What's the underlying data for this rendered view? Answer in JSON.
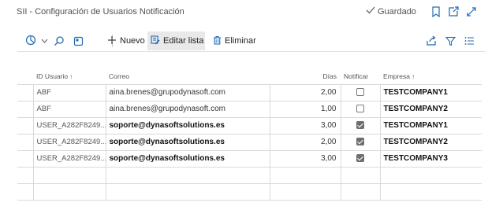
{
  "header": {
    "title": "SII - Configuración de Usuarios Notificación",
    "status": "Guardado"
  },
  "toolbar": {
    "nuevo_label": "Nuevo",
    "editar_lista_label": "Editar lista",
    "eliminar_label": "Eliminar"
  },
  "table": {
    "columns": {
      "id_usuario": "ID Usuario",
      "correo": "Correo",
      "dias": "Días",
      "notificar": "Notificar",
      "empresa": "Empresa"
    },
    "rows": [
      {
        "id_usuario": "ABF",
        "correo": "aina.brenes@grupodynasoft.com",
        "dias": "2,00",
        "notificar": false,
        "empresa": "TESTCOMPANY1"
      },
      {
        "id_usuario": "ABF",
        "correo": "aina.brenes@grupodynasoft.com",
        "dias": "1,00",
        "notificar": false,
        "empresa": "TESTCOMPANY2"
      },
      {
        "id_usuario": "USER_A282F8249...",
        "correo": "soporte@dynasoftsolutions.es",
        "dias": "3,00",
        "notificar": true,
        "empresa": "TESTCOMPANY1"
      },
      {
        "id_usuario": "USER_A282F8249...",
        "correo": "soporte@dynasoftsolutions.es",
        "dias": "2,00",
        "notificar": true,
        "empresa": "TESTCOMPANY2"
      },
      {
        "id_usuario": "USER_A282F8249...",
        "correo": "soporte@dynasoftsolutions.es",
        "dias": "3,00",
        "notificar": true,
        "empresa": "TESTCOMPANY3"
      }
    ]
  },
  "icons": {
    "saved": "checkmark-icon",
    "bookmark": "bookmark-icon",
    "open_new": "open-new-window-icon",
    "expand": "expand-icon",
    "analysis": "analysis-mode-icon",
    "search": "search-icon",
    "view": "view-icon",
    "share": "share-icon",
    "filter": "filter-icon",
    "list": "list-icon"
  }
}
